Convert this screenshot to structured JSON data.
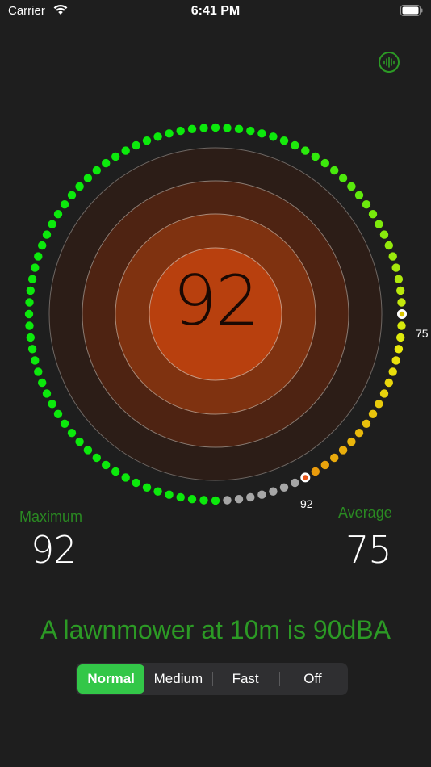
{
  "status_bar": {
    "carrier": "Carrier",
    "time": "6:41 PM"
  },
  "meter": {
    "current": "92",
    "current_value": 92,
    "average_value": 75,
    "average_marker_label": "75",
    "current_marker_label": "92"
  },
  "stats": {
    "maximum_label": "Maximum",
    "maximum_value": "92",
    "average_label": "Average",
    "average_value": "75"
  },
  "message": "A lawnmower at 10m is 90dBA",
  "speed": {
    "options": [
      "Normal",
      "Medium",
      "Fast",
      "Off"
    ],
    "selected": "Normal"
  },
  "colors": {
    "accent_green": "#2c9a25",
    "segment_active": "#33c748",
    "core": "#b8400e"
  }
}
